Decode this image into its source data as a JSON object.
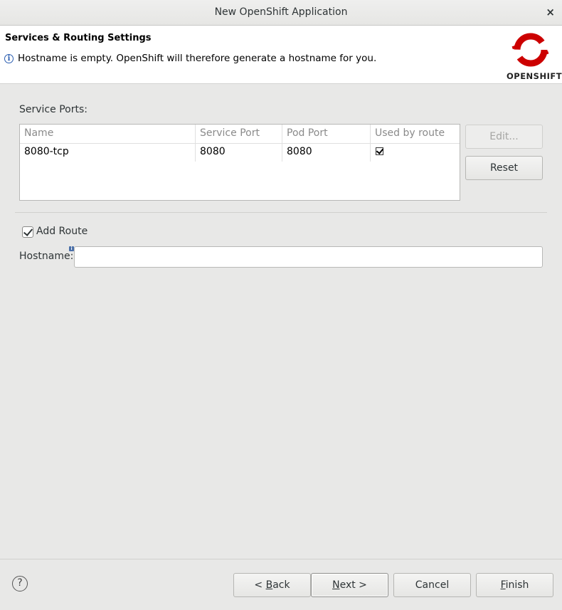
{
  "window": {
    "title": "New OpenShift Application",
    "close_glyph": "×"
  },
  "header": {
    "title": "Services & Routing Settings",
    "message": "Hostname is empty. OpenShift will therefore generate a hostname for you.",
    "logo_text": "OPENSHIFT",
    "logo_color": "#cc0000"
  },
  "service_ports": {
    "label": "Service Ports:",
    "columns": [
      "Name",
      "Service Port",
      "Pod Port",
      "Used by route"
    ],
    "rows": [
      {
        "name": "8080-tcp",
        "service_port": "8080",
        "pod_port": "8080",
        "used_by_route": true
      }
    ],
    "edit_label": "Edit...",
    "reset_label": "Reset"
  },
  "route": {
    "add_route_label": "Add Route",
    "add_route_checked": true,
    "hostname_label": "Hostname:",
    "hostname_value": ""
  },
  "footer": {
    "back_prefix": "< ",
    "back_mnemonic": "B",
    "back_rest": "ack",
    "next_mnemonic": "N",
    "next_rest": "ext >",
    "cancel_label": "Cancel",
    "finish_mnemonic": "F",
    "finish_rest": "inish",
    "help_glyph": "?"
  }
}
